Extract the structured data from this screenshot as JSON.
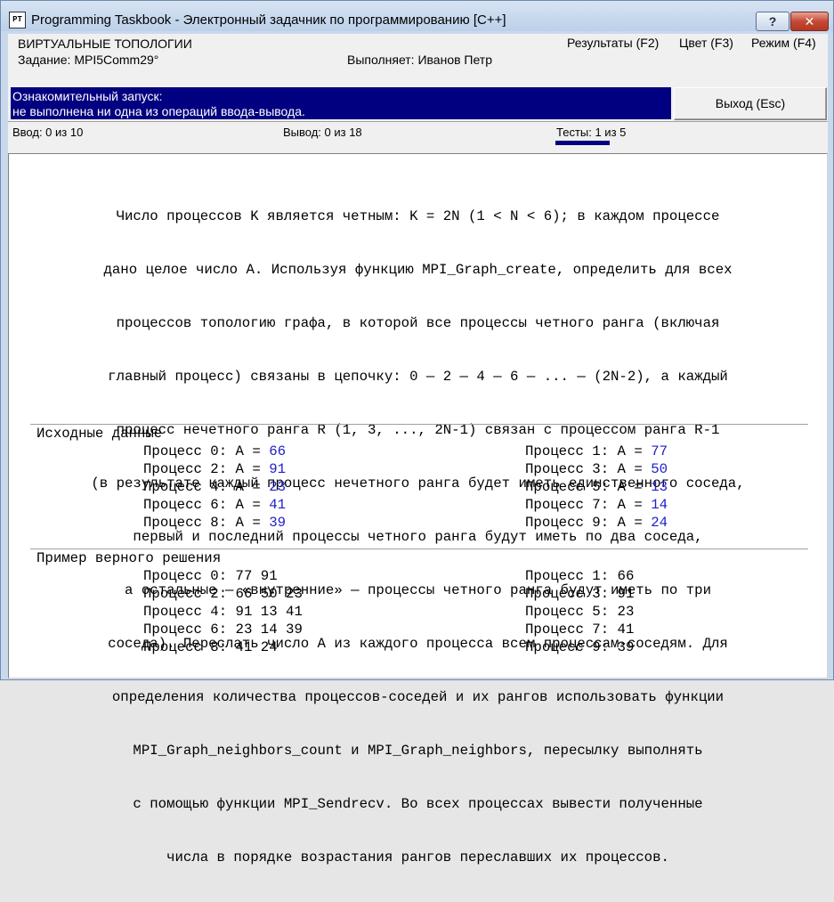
{
  "window": {
    "app_icon": "PT",
    "title": "Programming Taskbook - Электронный задачник по программированию [C++]",
    "help_label": "?",
    "close_label": "✕"
  },
  "header": {
    "group": "ВИРТУАЛЬНЫЕ ТОПОЛОГИИ",
    "task": "Задание: MPI5Comm29°",
    "student": "Выполняет: Иванов Петр",
    "menu": {
      "results": "Результаты (F2)",
      "color": "Цвет (F3)",
      "mode": "Режим (F4)"
    }
  },
  "status": {
    "line1": "Ознакомительный запуск:",
    "line2": " не выполнена ни одна из операций ввода-вывода.",
    "exit_label": "Выход (Esc)"
  },
  "counters": {
    "input": "Ввод: 0 из 10",
    "output": "Вывод: 0 из 18",
    "tests": "Тесты: 1 из 5"
  },
  "task_lines": [
    "Число процессов K является четным: K = 2N (1 < N < 6); в каждом процессе",
    "дано целое число A. Используя функцию MPI_Graph_create, определить для всех",
    "процессов топологию графа, в которой все процессы четного ранга (включая",
    "главный процесс) связаны в цепочку: 0 — 2 — 4 — 6 — ... — (2N-2), а каждый",
    "процесс нечетного ранга R (1, 3, ..., 2N-1) связан с процессом ранга R-1",
    "(в результате каждый процесс нечетного ранга будет иметь единственного соседа,",
    "первый и последний процессы четного ранга будут иметь по два соседа,",
    "а остальные — «внутренние» — процессы четного ранга будут иметь по три",
    "соседа). Переслать число A из каждого процесса всем процессам-соседям. Для",
    "определения количества процессов-соседей и их рангов использовать функции",
    "MPI_Graph_neighbors_count и MPI_Graph_neighbors, пересылку выполнять",
    "с помощью функции MPI_Sendrecv. Во всех процессах вывести полученные",
    "числа в порядке возрастания рангов переславших их процессов."
  ],
  "input_section": {
    "title": "Исходные данные",
    "rows": [
      {
        "left_label": "Процесс 0: A = ",
        "left_value": "66",
        "right_label": "Процесс 1: A = ",
        "right_value": "77"
      },
      {
        "left_label": "Процесс 2: A = ",
        "left_value": "91",
        "right_label": "Процесс 3: A = ",
        "right_value": "50"
      },
      {
        "left_label": "Процесс 4: A = ",
        "left_value": "23",
        "right_label": "Процесс 5: A = ",
        "right_value": "13"
      },
      {
        "left_label": "Процесс 6: A = ",
        "left_value": "41",
        "right_label": "Процесс 7: A = ",
        "right_value": "14"
      },
      {
        "left_label": "Процесс 8: A = ",
        "left_value": "39",
        "right_label": "Процесс 9: A = ",
        "right_value": "24"
      }
    ]
  },
  "example_section": {
    "title": "Пример верного решения",
    "rows": [
      {
        "left": "Процесс 0: 77 91",
        "right": "Процесс 1: 66"
      },
      {
        "left": "Процесс 2: 66 50 23",
        "right": "Процесс 3: 91"
      },
      {
        "left": "Процесс 4: 91 13 41",
        "right": "Процесс 5: 23"
      },
      {
        "left": "Процесс 6: 23 14 39",
        "right": "Процесс 7: 41"
      },
      {
        "left": "Процесс 8: 41 24",
        "right": "Процесс 9: 39"
      }
    ]
  },
  "colors": {
    "status_background": "#000080",
    "value_blue": "#2020c8"
  }
}
